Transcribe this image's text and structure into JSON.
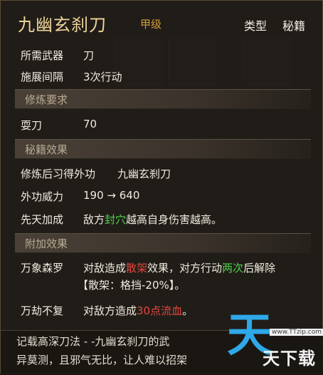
{
  "header": {
    "title": "九幽玄刹刀",
    "grade": "甲级",
    "type_label": "类型",
    "type_value": "秘籍"
  },
  "basic": {
    "weapon_label": "所需武器",
    "weapon_value": "刀",
    "interval_label": "施展间隔",
    "interval_value": "3次行动"
  },
  "practice": {
    "section_title": "修炼要求",
    "req_label": "耍刀",
    "req_value": "70"
  },
  "effect": {
    "section_title": "秘籍效果",
    "learn_label": "修炼后习得外功",
    "learn_value": "九幽玄刹刀",
    "power_label": "外功威力",
    "power_value": "190 → 640",
    "innate_label": "先天加成",
    "innate_pre": "敌方",
    "innate_hl": "封穴",
    "innate_post": "越高自身伤害越高。"
  },
  "extra": {
    "section_title": "附加效果",
    "e1_label": "万象森罗",
    "e1_pre": "对敌造成",
    "e1_hl1": "散架",
    "e1_mid": "效果，对方行动",
    "e1_hl2": "两次",
    "e1_post": "后解除",
    "e1_line2": "【散架：格挡-20%】。",
    "e2_label": "万劫不复",
    "e2_pre": "对敌方造成",
    "e2_hl": "30点流血",
    "e2_post": "。"
  },
  "footer": {
    "line1": "记载高深刀法 - -九幽玄刹刀的武",
    "line2": "异莫测，且邪气无比，让人难以招架"
  },
  "watermark": {
    "big": "天",
    "small": "天下载",
    "url": "www.TTzip.com"
  }
}
